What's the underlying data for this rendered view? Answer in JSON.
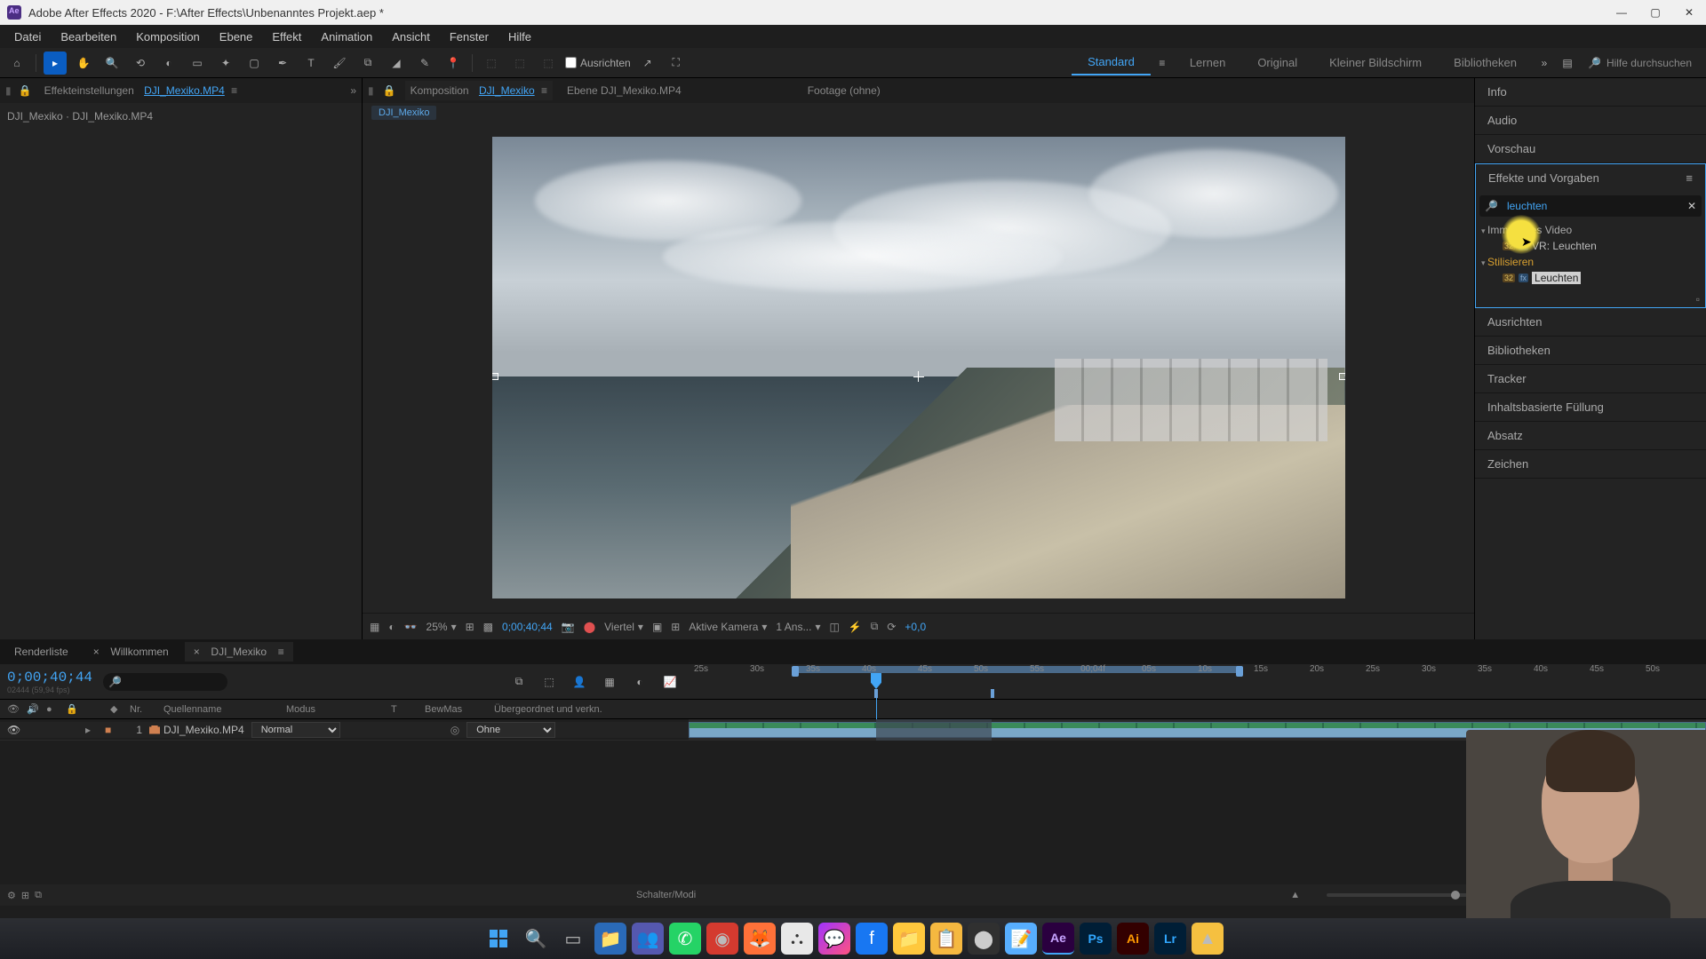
{
  "titlebar": {
    "app": "Adobe After Effects 2020",
    "path": "F:\\After Effects\\Unbenanntes Projekt.aep *"
  },
  "menu": [
    "Datei",
    "Bearbeiten",
    "Komposition",
    "Ebene",
    "Effekt",
    "Animation",
    "Ansicht",
    "Fenster",
    "Hilfe"
  ],
  "toolbar": {
    "snap_label": "Ausrichten"
  },
  "workspaces": {
    "items": [
      "Standard",
      "Lernen",
      "Original",
      "Kleiner Bildschirm",
      "Bibliotheken"
    ],
    "active": "Standard",
    "search_placeholder": "Hilfe durchsuchen"
  },
  "left_panel": {
    "tab1_label": "Effekteinstellungen",
    "tab1_link": "DJI_Mexiko.MP4",
    "breadcrumb": "DJI_Mexiko · DJI_Mexiko.MP4"
  },
  "viewer": {
    "tabs": [
      {
        "label": "Komposition",
        "link": "DJI_Mexiko",
        "active": true
      },
      {
        "label": "Ebene DJI_Mexiko.MP4",
        "active": false
      },
      {
        "label": "Footage (ohne)",
        "active": false
      }
    ],
    "comp_name": "DJI_Mexiko",
    "controls": {
      "zoom": "25%",
      "timecode": "0;00;40;44",
      "res": "Viertel",
      "camera": "Aktive Kamera",
      "views": "1 Ans...",
      "exposure": "+0,0"
    }
  },
  "right_panel": {
    "sections": [
      "Info",
      "Audio",
      "Vorschau"
    ],
    "effects": {
      "title": "Effekte und Vorgaben",
      "search_value": "leuchten",
      "tree": {
        "cat1": "Immersives Video",
        "cat1_item": "VR: Leuchten",
        "cat2": "Stilisieren",
        "cat2_item": "Leuchten"
      }
    },
    "sections_after": [
      "Ausrichten",
      "Bibliotheken",
      "Tracker",
      "Inhaltsbasierte Füllung",
      "Absatz",
      "Zeichen"
    ]
  },
  "timeline": {
    "tabs": [
      {
        "label": "Renderliste"
      },
      {
        "label": "Willkommen"
      },
      {
        "label": "DJI_Mexiko",
        "active": true
      }
    ],
    "timecode": "0;00;40;44",
    "frame_info": "02444 (59,94 fps)",
    "columns": {
      "nr": "Nr.",
      "source": "Quellenname",
      "mode": "Modus",
      "t": "T",
      "bewmas": "BewMas",
      "parent": "Übergeordnet und verkn."
    },
    "ruler_ticks": [
      "25s",
      "30s",
      "35s",
      "40s",
      "45s",
      "50s",
      "55s",
      "00;04f",
      "05s",
      "10s",
      "15s",
      "20s",
      "25s",
      "30s",
      "35s",
      "40s",
      "45s",
      "50s"
    ],
    "layer": {
      "index": "1",
      "name": "DJI_Mexiko.MP4",
      "mode": "Normal",
      "parent": "Ohne"
    },
    "footer_label": "Schalter/Modi"
  }
}
